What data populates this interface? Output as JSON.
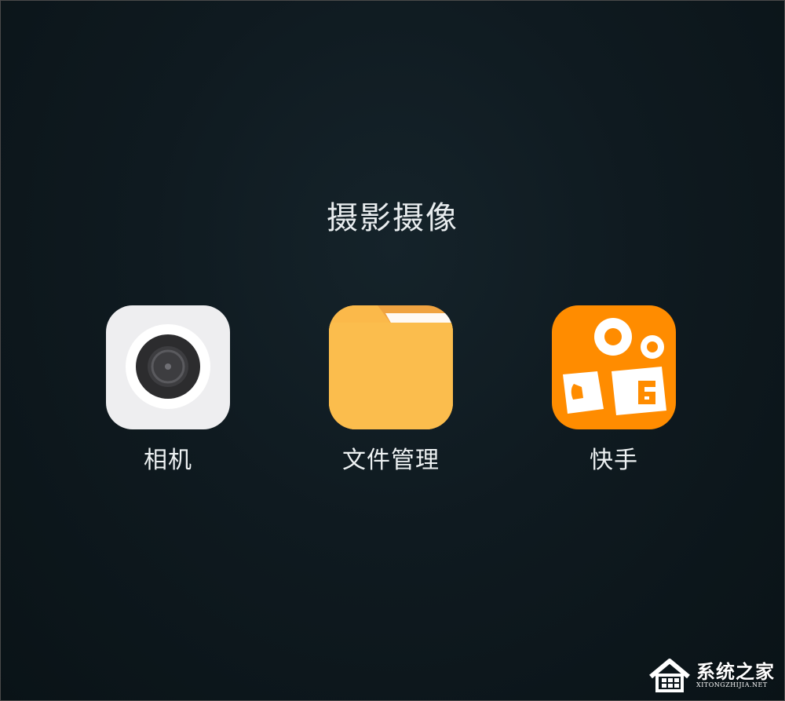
{
  "folder": {
    "title": "摄影摄像"
  },
  "apps": [
    {
      "label": "相机",
      "icon": "camera-icon"
    },
    {
      "label": "文件管理",
      "icon": "folder-icon"
    },
    {
      "label": "快手",
      "icon": "kuaishou-icon"
    }
  ],
  "watermark": {
    "name": "系统之家",
    "url": "XITONGZHIJIA.NET"
  },
  "colors": {
    "camera_bg": "#eeeef0",
    "folder_main": "#fbb94a",
    "folder_tab": "#f0a341",
    "kuaishou_bg": "#ff8c00"
  }
}
